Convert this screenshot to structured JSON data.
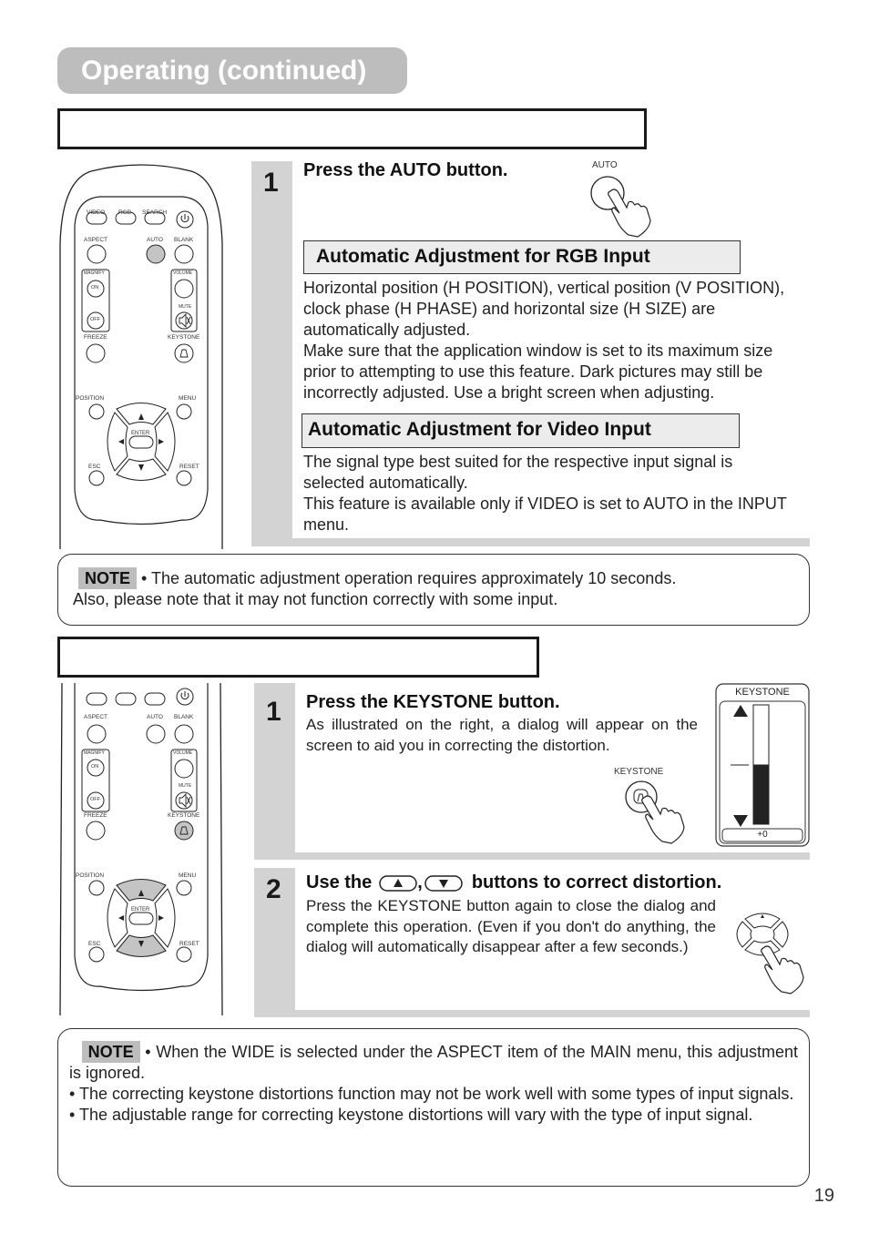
{
  "header": {
    "title": "Operating (continued)"
  },
  "auto_section": {
    "step1": {
      "number": "1",
      "heading": "Press the AUTO button.",
      "button_illustration_label": "AUTO"
    },
    "rgb": {
      "heading": "Automatic Adjustment for RGB Input",
      "lines": [
        "Horizontal position (H POSITION), vertical position (V POSITION),",
        "clock phase (H PHASE) and horizontal size (H SIZE) are",
        "automatically adjusted.",
        "Make sure that the application window is set to its maximum size",
        "prior to attempting to use this feature. Dark pictures may still be",
        "incorrectly adjusted. Use a bright screen when adjusting."
      ]
    },
    "video": {
      "heading": "Automatic Adjustment for Video Input",
      "lines": [
        "The signal type best suited for the respective input signal is",
        "selected automatically.",
        "This feature is available only if VIDEO is set to AUTO in the INPUT",
        "menu."
      ]
    },
    "note": {
      "badge": "NOTE",
      "line1": "• The automatic adjustment operation requires approximately 10 seconds.",
      "line2": "Also, please note that it may not function correctly with some input."
    }
  },
  "remote": {
    "labels": {
      "video": "VIDEO",
      "rgb": "RGB",
      "search": "SEARCH",
      "aspect": "ASPECT",
      "auto": "AUTO",
      "blank": "BLANK",
      "magnify": "MAGNIFY",
      "on": "ON",
      "off": "OFF",
      "volume": "VOLUME",
      "mute": "MUTE",
      "freeze": "FREEZE",
      "keystone": "KEYSTONE",
      "position": "POSITION",
      "menu": "MENU",
      "enter": "ENTER",
      "esc": "ESC",
      "reset": "RESET"
    },
    "highlight_color": "#c4c4c4"
  },
  "keystone_section": {
    "step1": {
      "number": "1",
      "heading": "Press the KEYSTONE button.",
      "text": "As illustrated on the right, a dialog will appear on the screen to aid you in correcting the distortion.",
      "button_illustration_label": "KEYSTONE"
    },
    "dialog": {
      "title": "KEYSTONE",
      "value": "+0",
      "level_fraction": 0.5
    },
    "step2": {
      "number": "2",
      "heading_prefix": "Use the",
      "heading_sep": ",",
      "heading_suffix": "buttons to correct distortion.",
      "text": "Press the KEYSTONE button again to close the dialog and complete this operation. (Even if you don't do anything, the dialog will automatically disappear after a few seconds.)"
    },
    "note": {
      "badge": "NOTE",
      "line1": "• When the WIDE is selected under the ASPECT item of the MAIN menu, this adjustment is ignored.",
      "bullet2": "• The correcting keystone distortions function may not be work well with some types of input signals.",
      "bullet3": "• The adjustable range for correcting keystone distortions will vary with the type of input signal."
    }
  },
  "footer": {
    "page_number": "19"
  }
}
